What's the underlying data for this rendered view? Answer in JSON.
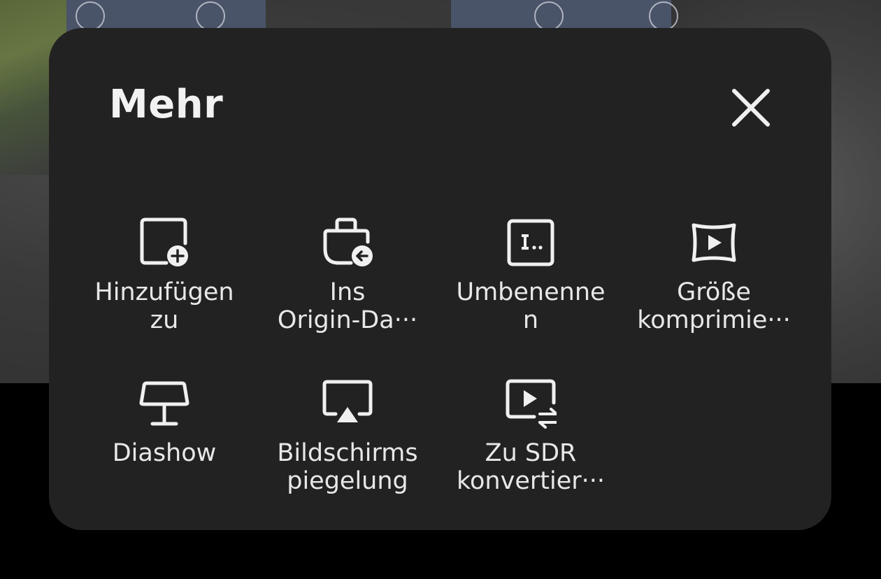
{
  "sheet": {
    "title": "Mehr",
    "close_icon": "close-icon"
  },
  "actions": [
    {
      "label": "Hinzufügen\nzu",
      "icon": "add-to-album-icon"
    },
    {
      "label": "Ins\nOrigin-Da···",
      "icon": "restore-original-icon"
    },
    {
      "label": "Umbenenne\nn",
      "icon": "rename-icon"
    },
    {
      "label": "Größe\nkomprimie···",
      "icon": "compress-size-icon"
    },
    {
      "label": "Diashow",
      "icon": "slideshow-icon"
    },
    {
      "label": "Bildschirms\npiegelung",
      "icon": "screen-mirroring-icon"
    },
    {
      "label": "Zu SDR\nkonvertier···",
      "icon": "convert-sdr-icon"
    }
  ],
  "colors": {
    "sheet_bg": "#232222",
    "text": "#e8e8e8",
    "icon": "#f0f0f0"
  }
}
